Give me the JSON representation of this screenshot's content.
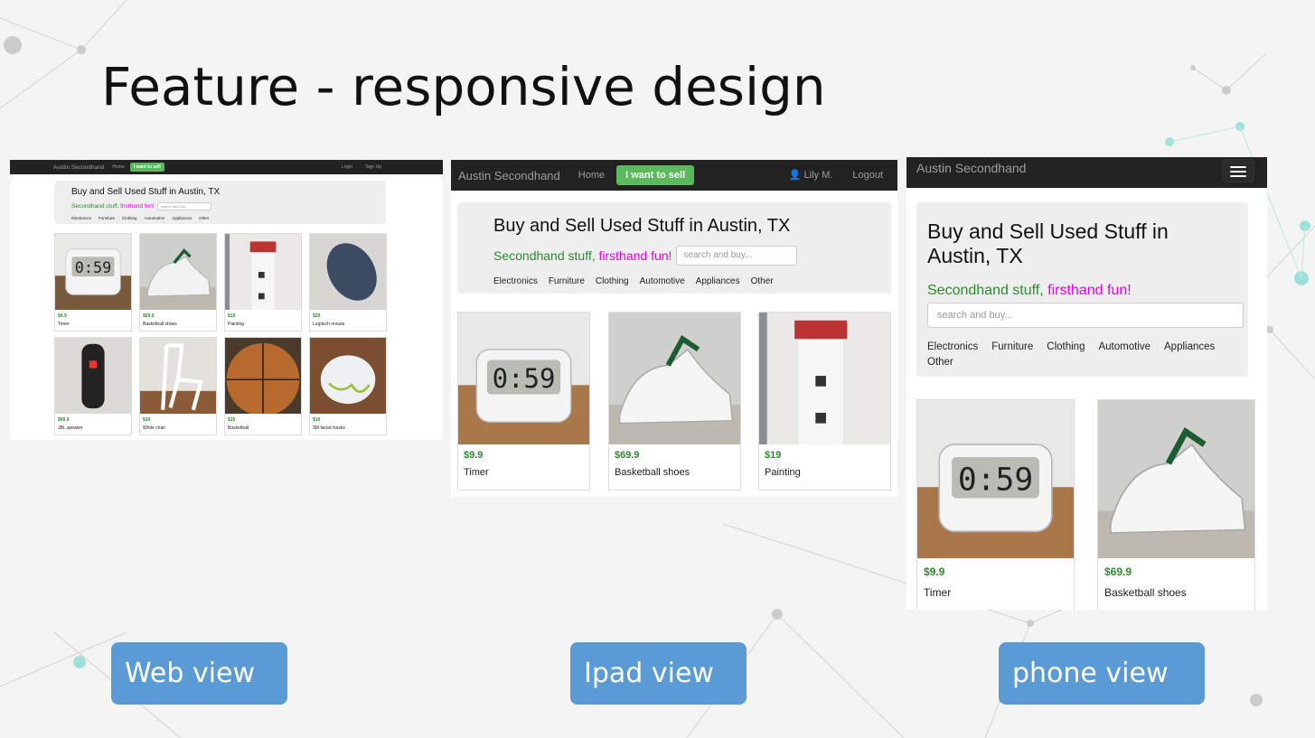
{
  "slide": {
    "title": "Feature - responsive design"
  },
  "site": {
    "brand": "Austin Secondhand",
    "home": "Home",
    "sell": "I want to sell",
    "web_sell": "I want to sell",
    "login": "Login",
    "signup": "Sign Up",
    "user": "Lily M.",
    "logout": "Logout",
    "heading": "Buy and Sell Used Stuff in Austin, TX",
    "tagline_green": "Secondhand stuff,",
    "tagline_pink": "firsthand fun!",
    "search_placeholder": "search and buy...",
    "categories": [
      "Electronics",
      "Furniture",
      "Clothing",
      "Automotive",
      "Appliances",
      "Other"
    ]
  },
  "products": [
    {
      "price": "$9.9",
      "name": "Timer",
      "icon": "timer"
    },
    {
      "price": "$69.9",
      "name": "Basketball shoes",
      "icon": "shoes"
    },
    {
      "price": "$19",
      "name": "Painting",
      "icon": "lighthouse"
    },
    {
      "price": "$29",
      "name": "Logitech mouse",
      "icon": "mouse"
    },
    {
      "price": "$69.9",
      "name": "JBL speaker",
      "icon": "speaker"
    },
    {
      "price": "$10",
      "name": "White chair",
      "icon": "chair"
    },
    {
      "price": "$15",
      "name": "Basketball",
      "icon": "basketball"
    },
    {
      "price": "$10",
      "name": "3M facial masks",
      "icon": "masks"
    }
  ],
  "views": {
    "web": "Web view",
    "ipad": "Ipad view",
    "phone": "phone view"
  },
  "colors": {
    "navbar": "#222222",
    "sell_button": "#5cb85c",
    "tagline_green": "#2d8a2d",
    "tagline_pink": "#e600e6",
    "view_button": "#5b9bd5"
  }
}
